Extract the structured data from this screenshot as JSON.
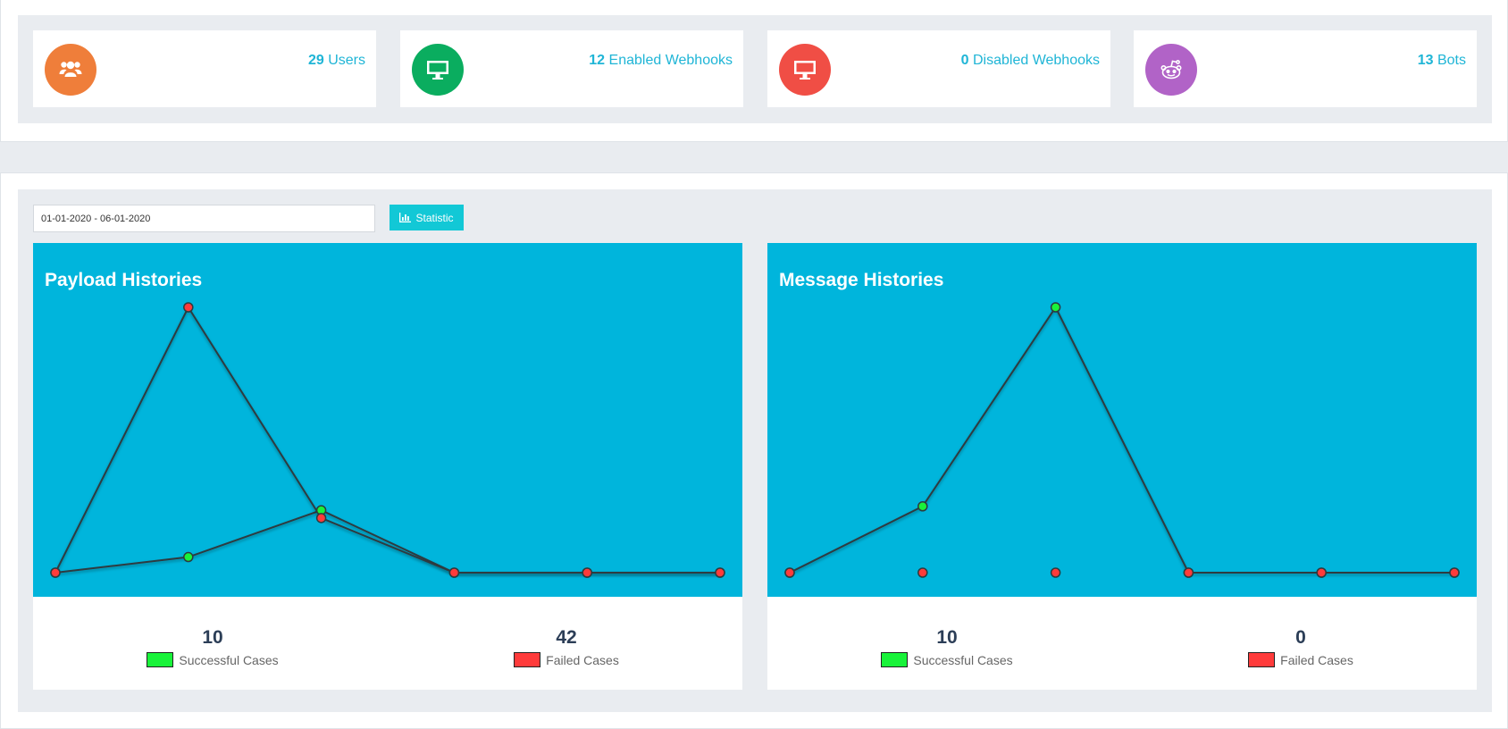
{
  "stats": [
    {
      "value": "29",
      "label": "Users",
      "color": "#ef7e3a",
      "icon": "users-icon"
    },
    {
      "value": "12",
      "label": "Enabled Webhooks",
      "color": "#0aad5f",
      "icon": "monitor-icon"
    },
    {
      "value": "0",
      "label": "Disabled Webhooks",
      "color": "#f04e45",
      "icon": "monitor-icon"
    },
    {
      "value": "13",
      "label": "Bots",
      "color": "#b163c7",
      "icon": "reddit-bot-icon"
    }
  ],
  "filter": {
    "date_range": "01-01-2020 - 06-01-2020",
    "button_label": "Statistic"
  },
  "colors": {
    "success": "#19f33a",
    "failed": "#ff3b3b",
    "chart_bg": "#00b5dc",
    "line": "#2d3b3f"
  },
  "charts": [
    {
      "title": "Payload Histories",
      "successful_count": "10",
      "successful_label": "Successful Cases",
      "failed_count": "42",
      "failed_label": "Failed Cases"
    },
    {
      "title": "Message Histories",
      "successful_count": "10",
      "successful_label": "Successful Cases",
      "failed_count": "0",
      "failed_label": "Failed Cases"
    }
  ],
  "chart_data": [
    {
      "type": "line",
      "title": "Payload Histories",
      "x": [
        1,
        2,
        3,
        4,
        5,
        6
      ],
      "series": [
        {
          "name": "Successful Cases",
          "values": [
            0,
            2,
            8,
            0,
            0,
            0
          ]
        },
        {
          "name": "Failed Cases",
          "values": [
            0,
            34,
            7,
            0,
            0,
            0
          ]
        }
      ],
      "ylim": [
        0,
        34
      ],
      "grid": false
    },
    {
      "type": "line",
      "title": "Message Histories",
      "x": [
        1,
        2,
        3,
        4,
        5,
        6
      ],
      "series": [
        {
          "name": "Successful Cases",
          "values": [
            0,
            2,
            8,
            0,
            0,
            0
          ]
        },
        {
          "name": "Failed Cases",
          "values": [
            0,
            0,
            0,
            0,
            0,
            0
          ]
        }
      ],
      "ylim": [
        0,
        8
      ],
      "grid": false
    }
  ]
}
